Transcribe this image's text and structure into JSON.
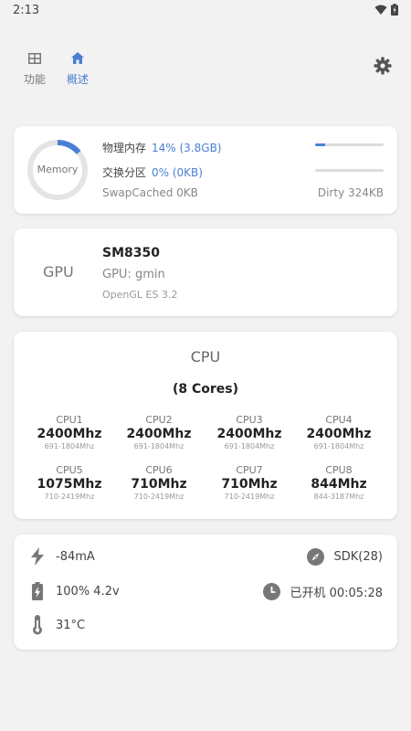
{
  "status_bar": {
    "time": "2:13"
  },
  "tabs": [
    {
      "label": "功能",
      "icon": "grid-icon",
      "active": false
    },
    {
      "label": "概述",
      "icon": "home-icon",
      "active": true
    }
  ],
  "memory": {
    "ring_label": "Memory",
    "ring_fraction": 0.14,
    "physical": {
      "label": "物理内存",
      "value": "14% (3.8GB)",
      "fraction": 0.14
    },
    "swap": {
      "label": "交换分区",
      "value": "0% (0KB)",
      "fraction": 0.0
    },
    "swap_cached": "SwapCached  0KB",
    "dirty": "Dirty  324KB"
  },
  "gpu": {
    "title": "GPU",
    "model": "SM8350",
    "vendor": "GPU: gmin",
    "opengl": "OpenGL ES 3.2"
  },
  "cpu": {
    "title": "CPU",
    "cores_label": "(8 Cores)",
    "cores": [
      {
        "name": "CPU1",
        "freq": "2400Mhz",
        "range": "691-1804Mhz"
      },
      {
        "name": "CPU2",
        "freq": "2400Mhz",
        "range": "691-1804Mhz"
      },
      {
        "name": "CPU3",
        "freq": "2400Mhz",
        "range": "691-1804Mhz"
      },
      {
        "name": "CPU4",
        "freq": "2400Mhz",
        "range": "691-1804Mhz"
      },
      {
        "name": "CPU5",
        "freq": "1075Mhz",
        "range": "710-2419Mhz"
      },
      {
        "name": "CPU6",
        "freq": "710Mhz",
        "range": "710-2419Mhz"
      },
      {
        "name": "CPU7",
        "freq": "710Mhz",
        "range": "710-2419Mhz"
      },
      {
        "name": "CPU8",
        "freq": "844Mhz",
        "range": "844-3187Mhz"
      }
    ]
  },
  "battery": {
    "current": "-84mA",
    "sdk": "SDK(28)",
    "level": "100% 4.2v",
    "uptime": "已开机 00:05:28",
    "temperature": "31°C"
  },
  "colors": {
    "accent": "#4a7fd4",
    "background": "#f2f2f2",
    "card": "#ffffff"
  }
}
